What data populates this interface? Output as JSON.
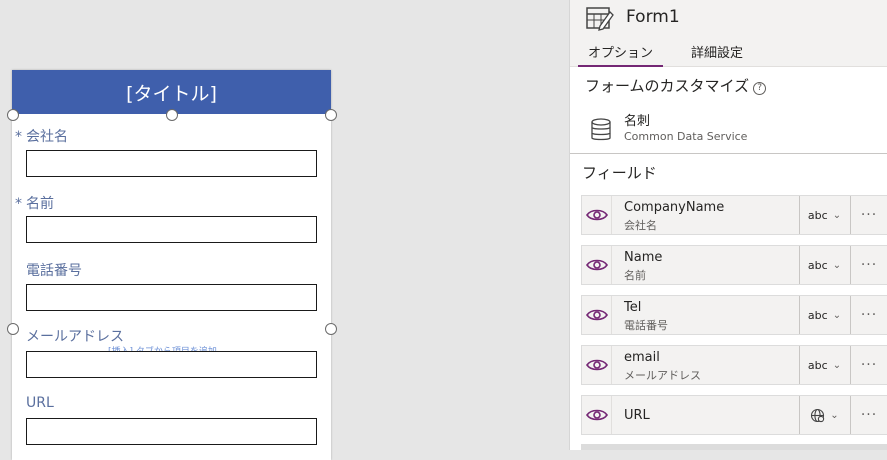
{
  "canvas": {
    "title": "[タイトル]",
    "hint_text": "[挿入] タブから項目を追加",
    "fields": [
      {
        "label": "会社名",
        "required": "*"
      },
      {
        "label": "名前",
        "required": "*"
      },
      {
        "label": "電話番号",
        "required": ""
      },
      {
        "label": "メールアドレス",
        "required": ""
      },
      {
        "label": "URL",
        "required": ""
      }
    ]
  },
  "panel": {
    "title": "Form1",
    "tabs": [
      {
        "label": "オプション",
        "active": true
      },
      {
        "label": "詳細設定",
        "active": false
      }
    ],
    "customize_title": "フォームのカスタマイズ",
    "help_glyph": "?",
    "data_source": {
      "name": "名刺",
      "type": "Common Data Service"
    },
    "fields_title": "フィールド",
    "field_rows": [
      {
        "name": "CompanyName",
        "display": "会社名",
        "type_label": "abc",
        "type_icon": "text-type-icon"
      },
      {
        "name": "Name",
        "display": "名前",
        "type_label": "abc",
        "type_icon": "text-type-icon"
      },
      {
        "name": "Tel",
        "display": "電話番号",
        "type_label": "abc",
        "type_icon": "text-type-icon"
      },
      {
        "name": "email",
        "display": "メールアドレス",
        "type_label": "abc",
        "type_icon": "text-type-icon"
      },
      {
        "name": "URL",
        "display": "",
        "type_label": "",
        "type_icon": "globe-icon"
      }
    ],
    "chevron_glyph": "⌄",
    "more_glyph": "···"
  },
  "colors": {
    "title_bar": "#3f5fac",
    "accent": "#742774",
    "label": "#5a6f9e"
  }
}
